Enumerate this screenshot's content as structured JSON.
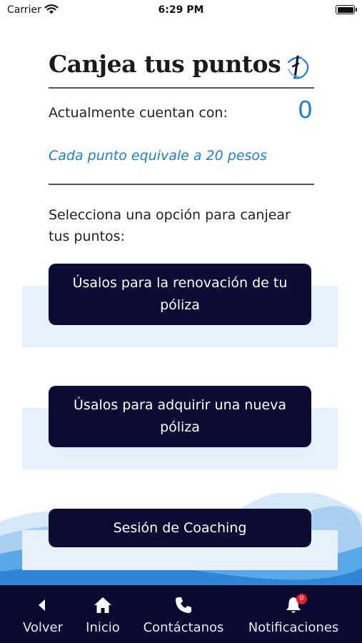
{
  "status_bar": {
    "carrier": "Carrier",
    "time": "6:29 PM"
  },
  "header": {
    "title": "Canjea tus puntos",
    "logo_icon": "brand-logo-icon"
  },
  "points": {
    "label": "Actualmente cuentan con:",
    "value": "0",
    "equivalence": "Cada punto equivale a 20 pesos"
  },
  "instruction": "Selecciona una opción para canjear tus puntos:",
  "options": [
    {
      "label": "Úsalos para la renovación de tu póliza"
    },
    {
      "label": "Úsalos para adquirir una nueva póliza"
    },
    {
      "label": "Sesión de Coaching"
    }
  ],
  "tab_bar": {
    "items": [
      {
        "label": "Volver",
        "icon": "back-icon"
      },
      {
        "label": "Inicio",
        "icon": "home-icon"
      },
      {
        "label": "Contáctanos",
        "icon": "phone-icon"
      },
      {
        "label": "Notificaciones",
        "icon": "bell-icon",
        "badge": "0"
      }
    ]
  },
  "colors": {
    "accent": "#1a7fd6",
    "button": "#0b0b33",
    "tab_bar": "#0a0a30",
    "panel": "#e6f1fb",
    "badge": "#e0202a"
  }
}
